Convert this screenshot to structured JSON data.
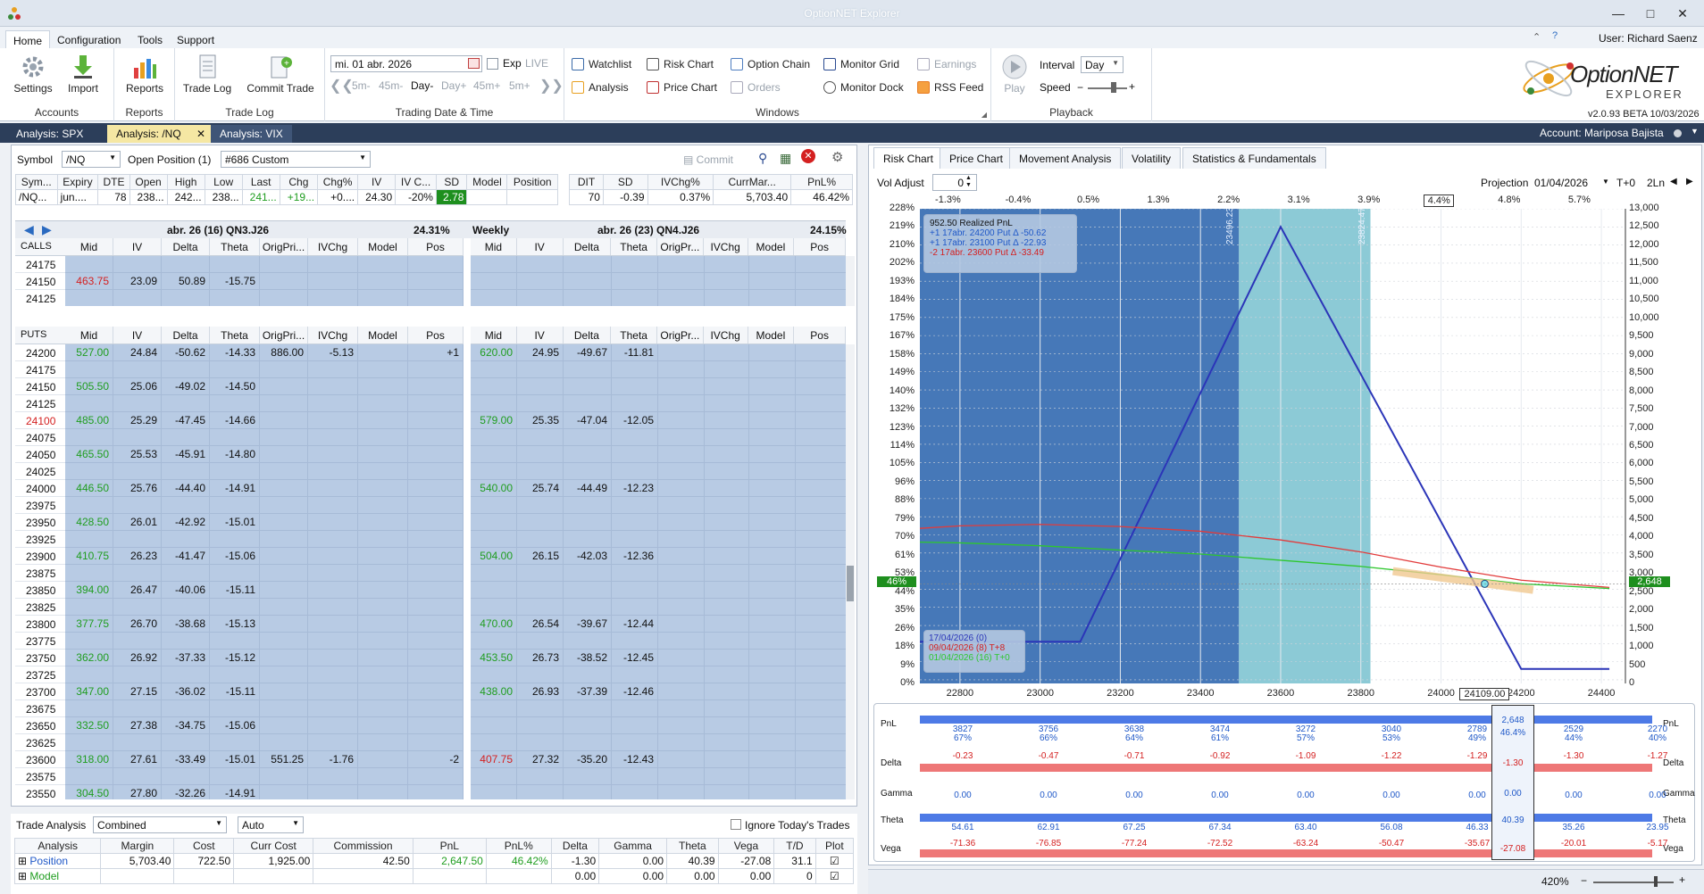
{
  "app": {
    "title": "OptionNET Explorer",
    "user": "User: Richard Saenz",
    "version": "v2.0.93 BETA 10/03/2026",
    "account": "Account: Mariposa Bajista",
    "logo_line1": "OptionNET",
    "logo_line2": "EXPLORER"
  },
  "menu": [
    "Home",
    "Configuration",
    "Tools",
    "Support"
  ],
  "ribbon": {
    "accounts": {
      "label": "Accounts",
      "settings": "Settings",
      "import": "Import"
    },
    "reports": {
      "label": "Reports",
      "reports": "Reports"
    },
    "tradelog": {
      "label": "Trade Log",
      "trade_log": "Trade Log",
      "commit_trade": "Commit Trade"
    },
    "trading": {
      "label": "Trading Date & Time",
      "date": "mi. 01 abr. 2026",
      "exp": "Exp",
      "live": "LIVE",
      "steps": [
        "5m-",
        "45m-",
        "Day-",
        "Day+",
        "45m+",
        "5m+"
      ]
    },
    "windows": {
      "label": "Windows",
      "items": [
        "Watchlist",
        "Risk Chart",
        "Option Chain",
        "Monitor Grid",
        "Earnings",
        "Analysis",
        "Price Chart",
        "Orders",
        "Monitor Dock",
        "RSS Feed"
      ]
    },
    "playback": {
      "label": "Playback",
      "play": "Play",
      "interval_label": "Interval",
      "interval": "Day",
      "speed": "Speed"
    }
  },
  "doc_tabs": [
    "Analysis: SPX",
    "Analysis: /NQ",
    "Analysis: VIX"
  ],
  "symbol_bar": {
    "symbol_label": "Symbol",
    "symbol": "/NQ",
    "open_position": "Open Position (1)",
    "position": "#686 Custom",
    "commit": "Commit"
  },
  "quote": {
    "headers": [
      "Sym...",
      "Expiry",
      "DTE",
      "Open",
      "High",
      "Low",
      "Last",
      "Chg",
      "Chg%",
      "IV",
      "IV C...",
      "SD",
      "Model",
      "Position"
    ],
    "row": [
      "/NQ...",
      "jun....",
      "78",
      "238...",
      "242...",
      "238...",
      "241...",
      "+19...",
      "+0....",
      "24.30",
      "-20%",
      "2.78",
      "",
      ""
    ]
  },
  "stats": {
    "headers": [
      "DIT",
      "SD",
      "IVChg%",
      "CurrMar...",
      "PnL%"
    ],
    "row": [
      "70",
      "-0.39",
      "0.37%",
      "5,703.40",
      "46.42%"
    ]
  },
  "chain_left": {
    "title": "abr. 26 (16)  QN3.J26",
    "pct": "24.31%"
  },
  "chain_right": {
    "tag": "Weekly",
    "title": "abr. 26 (23)  QN4.J26",
    "pct": "24.15%"
  },
  "chain_cols_left": [
    "Mid",
    "IV",
    "Delta",
    "Theta",
    "OrigPri...",
    "IVChg",
    "Model",
    "Pos"
  ],
  "chain_cols_right": [
    "Mid",
    "IV",
    "Delta",
    "Theta",
    "OrigPr...",
    "IVChg",
    "Model",
    "Pos"
  ],
  "calls_label": "CALLS",
  "puts_label": "PUTS",
  "calls": [
    {
      "strike": "24175",
      "mid": "",
      "iv": "",
      "delta": "",
      "theta": ""
    },
    {
      "strike": "24150",
      "mid": "463.75",
      "iv": "23.09",
      "delta": "50.89",
      "theta": "-15.75"
    },
    {
      "strike": "24125",
      "mid": "",
      "iv": "",
      "delta": "",
      "theta": ""
    }
  ],
  "puts": [
    {
      "strike": "24200",
      "mid": "527.00",
      "iv": "24.84",
      "delta": "-50.62",
      "theta": "-14.33",
      "orig": "886.00",
      "ivchg": "-5.13",
      "pos": "+1",
      "rmid": "620.00",
      "riv": "24.95",
      "rdelta": "-49.67",
      "rtheta": "-11.81"
    },
    {
      "strike": "24175"
    },
    {
      "strike": "24150",
      "mid": "505.50",
      "iv": "25.06",
      "delta": "-49.02",
      "theta": "-14.50"
    },
    {
      "strike": "24125"
    },
    {
      "strike": "24100",
      "mid": "485.00",
      "iv": "25.29",
      "delta": "-47.45",
      "theta": "-14.66",
      "rmid": "579.00",
      "riv": "25.35",
      "rdelta": "-47.04",
      "rtheta": "-12.05"
    },
    {
      "strike": "24075"
    },
    {
      "strike": "24050",
      "mid": "465.50",
      "iv": "25.53",
      "delta": "-45.91",
      "theta": "-14.80"
    },
    {
      "strike": "24025"
    },
    {
      "strike": "24000",
      "mid": "446.50",
      "iv": "25.76",
      "delta": "-44.40",
      "theta": "-14.91",
      "rmid": "540.00",
      "riv": "25.74",
      "rdelta": "-44.49",
      "rtheta": "-12.23"
    },
    {
      "strike": "23975"
    },
    {
      "strike": "23950",
      "mid": "428.50",
      "iv": "26.01",
      "delta": "-42.92",
      "theta": "-15.01"
    },
    {
      "strike": "23925"
    },
    {
      "strike": "23900",
      "mid": "410.75",
      "iv": "26.23",
      "delta": "-41.47",
      "theta": "-15.06",
      "rmid": "504.00",
      "riv": "26.15",
      "rdelta": "-42.03",
      "rtheta": "-12.36"
    },
    {
      "strike": "23875"
    },
    {
      "strike": "23850",
      "mid": "394.00",
      "iv": "26.47",
      "delta": "-40.06",
      "theta": "-15.11"
    },
    {
      "strike": "23825"
    },
    {
      "strike": "23800",
      "mid": "377.75",
      "iv": "26.70",
      "delta": "-38.68",
      "theta": "-15.13",
      "rmid": "470.00",
      "riv": "26.54",
      "rdelta": "-39.67",
      "rtheta": "-12.44"
    },
    {
      "strike": "23775"
    },
    {
      "strike": "23750",
      "mid": "362.00",
      "iv": "26.92",
      "delta": "-37.33",
      "theta": "-15.12",
      "rmid": "453.50",
      "riv": "26.73",
      "rdelta": "-38.52",
      "rtheta": "-12.45"
    },
    {
      "strike": "23725"
    },
    {
      "strike": "23700",
      "mid": "347.00",
      "iv": "27.15",
      "delta": "-36.02",
      "theta": "-15.11",
      "rmid": "438.00",
      "riv": "26.93",
      "rdelta": "-37.39",
      "rtheta": "-12.46"
    },
    {
      "strike": "23675"
    },
    {
      "strike": "23650",
      "mid": "332.50",
      "iv": "27.38",
      "delta": "-34.75",
      "theta": "-15.06"
    },
    {
      "strike": "23625"
    },
    {
      "strike": "23600",
      "mid": "318.00",
      "iv": "27.61",
      "delta": "-33.49",
      "theta": "-15.01",
      "orig": "551.25",
      "ivchg": "-1.76",
      "pos": "-2",
      "rmid": "407.75",
      "riv": "27.32",
      "rdelta": "-35.20",
      "rtheta": "-12.43"
    },
    {
      "strike": "23575"
    },
    {
      "strike": "23550",
      "mid": "304.50",
      "iv": "27.80",
      "delta": "-32.26",
      "theta": "-14.91"
    }
  ],
  "trade_analysis": {
    "label": "Trade Analysis",
    "mode": "Combined",
    "auto": "Auto",
    "ignore": "Ignore Today's Trades",
    "headers": [
      "Analysis",
      "Margin",
      "Cost",
      "Curr Cost",
      "Commission",
      "PnL",
      "PnL%",
      "Delta",
      "Gamma",
      "Theta",
      "Vega",
      "T/D",
      "Plot"
    ],
    "position": [
      "Position",
      "5,703.40",
      "722.50",
      "1,925.00",
      "42.50",
      "2,647.50",
      "46.42%",
      "-1.30",
      "0.00",
      "40.39",
      "-27.08",
      "31.1",
      ""
    ],
    "model": [
      "Model",
      "",
      "",
      "",
      "",
      "",
      "",
      "0.00",
      "0.00",
      "0.00",
      "0.00",
      "0",
      ""
    ]
  },
  "right_tabs": [
    "Risk Chart",
    "Price Chart",
    "Movement Analysis",
    "Volatility",
    "Statistics & Fundamentals"
  ],
  "risk": {
    "vol_adjust_label": "Vol Adjust",
    "vol_adjust": "0",
    "projection_label": "Projection",
    "projection": "01/04/2026",
    "t0": "T+0",
    "ln": "2Ln",
    "top_pct": [
      "-1.3%",
      "-0.4%",
      "0.5%",
      "1.3%",
      "2.2%",
      "3.1%",
      "3.9%",
      "4.4%",
      "4.8%",
      "5.7%"
    ],
    "y_left": [
      "228%",
      "219%",
      "210%",
      "202%",
      "193%",
      "184%",
      "175%",
      "167%",
      "158%",
      "149%",
      "140%",
      "132%",
      "123%",
      "114%",
      "105%",
      "96%",
      "88%",
      "79%",
      "70%",
      "61%",
      "53%",
      "44%",
      "35%",
      "26%",
      "18%",
      "9%",
      "0%"
    ],
    "y_right": [
      "13,000",
      "12,500",
      "12,000",
      "11,500",
      "11,000",
      "10,500",
      "10,000",
      "9,500",
      "9,000",
      "8,500",
      "8,000",
      "7,500",
      "7,000",
      "6,500",
      "6,000",
      "5,500",
      "5,000",
      "4,500",
      "4,000",
      "3,500",
      "3,000",
      "2,500",
      "2,000",
      "1,500",
      "1,000",
      "500",
      "0"
    ],
    "x": [
      "22800",
      "23000",
      "23200",
      "23400",
      "23600",
      "23800",
      "24000",
      "24200",
      "24400"
    ],
    "x_current": "24109.00",
    "pnl_pct_marker": "46%",
    "pnl_marker": "2,648",
    "sd_left": "23496.23",
    "sd_right": "23824.47",
    "legend_title": "952.50 Realized PnL",
    "legend": [
      "+1 17abr. 24200 Put Δ -50.62",
      "+1 17abr. 23100 Put Δ -22.93",
      "-2 17abr. 23600 Put Δ -33.49"
    ],
    "dates": [
      "17/04/2026 (0)",
      "09/04/2026 (8) T+8",
      "01/04/2026 (16) T+0"
    ],
    "colors": {
      "expiry": "#2b35b8",
      "t8": "#e23b3b",
      "t0": "#2ec72e",
      "zone_dark": "#4678b8",
      "zone_light": "#8ccad6"
    },
    "chart_data": {
      "type": "line",
      "xlim": [
        22700,
        24460
      ],
      "ylim_left_pct": [
        0,
        228
      ],
      "ylim_right": [
        -100,
        13000
      ],
      "series": [
        {
          "name": "17/04/2026 (0)",
          "x": [
            22700,
            23100,
            23600,
            24200,
            24420
          ],
          "y": [
            1050,
            1050,
            12500,
            300,
            300
          ]
        },
        {
          "name": "09/04/2026 (8) T+8",
          "x": [
            22700,
            22800,
            23000,
            23200,
            23400,
            23600,
            23800,
            24000,
            24200,
            24420
          ],
          "y": [
            4180,
            4250,
            4290,
            4230,
            4100,
            3860,
            3530,
            3110,
            2750,
            2550
          ]
        },
        {
          "name": "01/04/2026 (16) T+0",
          "x": [
            22700,
            22800,
            23000,
            23200,
            23400,
            23600,
            23800,
            24000,
            24200,
            24420
          ],
          "y": [
            3800,
            3780,
            3700,
            3580,
            3470,
            3300,
            3130,
            2900,
            2650,
            2520
          ]
        }
      ]
    }
  },
  "greeks": {
    "labels": [
      "PnL",
      "Delta",
      "Gamma",
      "Theta",
      "Vega"
    ],
    "pnl": [
      "3827",
      "3756",
      "3638",
      "3474",
      "3272",
      "3040",
      "2789",
      "2529",
      "2270"
    ],
    "pnl_pct": [
      "67%",
      "66%",
      "64%",
      "61%",
      "57%",
      "53%",
      "49%",
      "44%",
      "40%"
    ],
    "delta": [
      "-0.23",
      "-0.47",
      "-0.71",
      "-0.92",
      "-1.09",
      "-1.22",
      "-1.29",
      "-1.30",
      "-1.27"
    ],
    "gamma": [
      "0.00",
      "0.00",
      "0.00",
      "0.00",
      "0.00",
      "0.00",
      "0.00",
      "0.00",
      "0.00"
    ],
    "theta": [
      "54.61",
      "62.91",
      "67.25",
      "67.34",
      "63.40",
      "56.08",
      "46.33",
      "35.26",
      "23.95"
    ],
    "vega": [
      "-71.36",
      "-76.85",
      "-77.24",
      "-72.52",
      "-63.24",
      "-50.47",
      "-35.67",
      "-20.01",
      "-5.17"
    ],
    "cur": {
      "pnl": "2,648",
      "pnl_pct": "46.4%",
      "delta": "-1.30",
      "gamma": "0.00",
      "theta": "40.39",
      "vega": "-27.08"
    }
  },
  "status": {
    "zoom": "420%"
  }
}
